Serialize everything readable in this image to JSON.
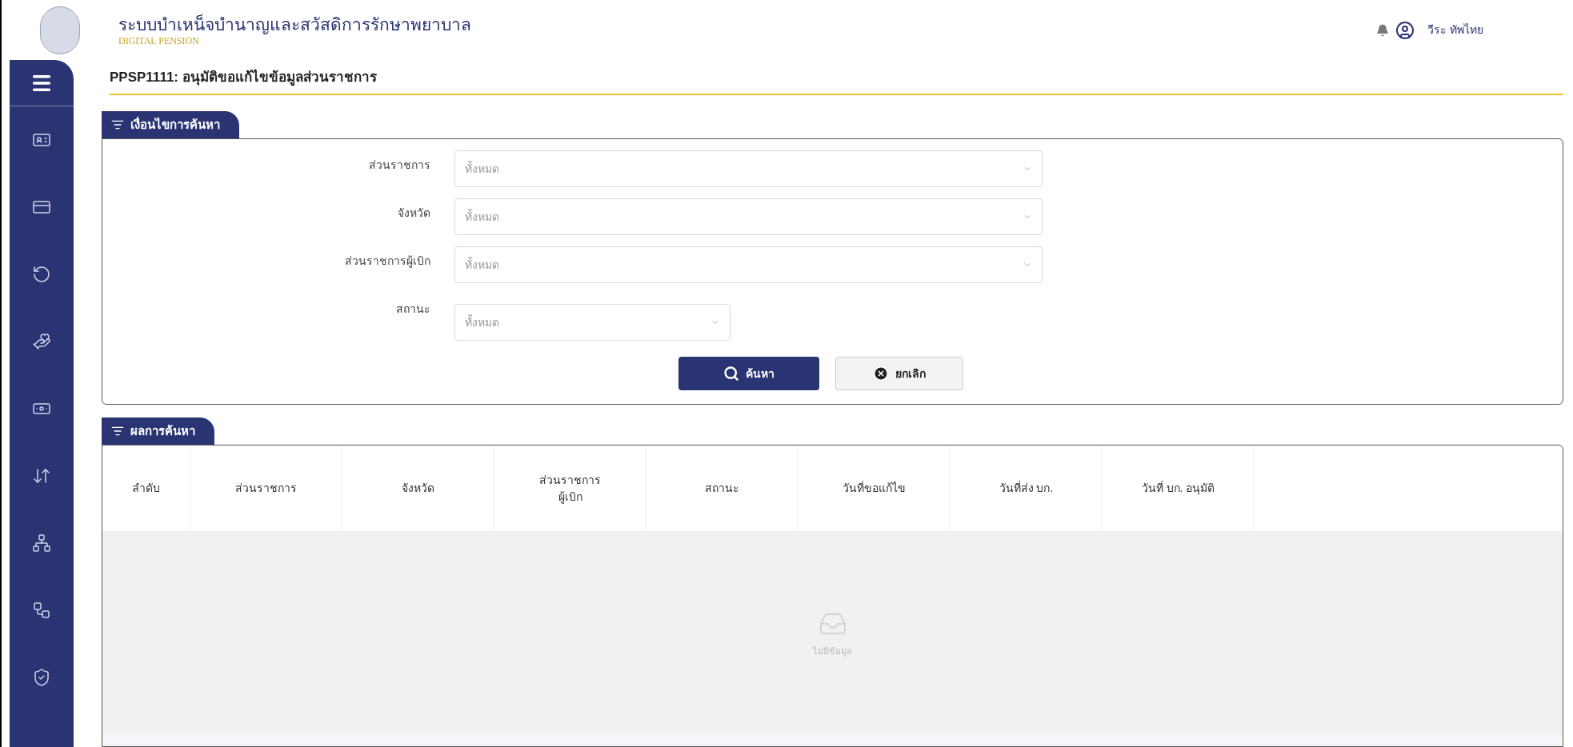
{
  "header": {
    "title": "ระบบบำเหน็จบำนาญและสวัสดิการรักษาพยาบาล",
    "subtitle": "DIGITAL PENSION",
    "user": "วีระ ทัพไทย"
  },
  "page_title": "PPSP1111: อนุมัติขอแก้ไขข้อมูลส่วนราชการ",
  "filter": {
    "title": "เงื่อนไขการค้นหา",
    "fields": [
      {
        "label": "ส่วนราชการ",
        "placeholder": "ทั้งหมด",
        "wide": true
      },
      {
        "label": "จังหวัด",
        "placeholder": "ทั้งหมด",
        "wide": true
      },
      {
        "label": "ส่วนราชการผู้เบิก",
        "placeholder": "ทั้งหมด",
        "wide": true
      },
      {
        "label": "สถานะ",
        "placeholder": "ทั้งหมด",
        "wide": false
      }
    ],
    "buttons": [
      {
        "kind": "primary",
        "label": "ค้นหา"
      },
      {
        "kind": "cancel",
        "label": "ยกเลิก"
      }
    ]
  },
  "results": {
    "title": "ผลการค้นหา",
    "columns": [
      {
        "lines": [
          "ลำดับ"
        ]
      },
      {
        "lines": [
          "ส่วนราชการ"
        ]
      },
      {
        "lines": [
          "จังหวัด"
        ]
      },
      {
        "lines": [
          "ส่วนราชการ",
          "ผู้เบิก"
        ]
      },
      {
        "lines": [
          "สถานะ"
        ]
      },
      {
        "lines": [
          "วันที่ขอแก้ไข"
        ]
      },
      {
        "lines": [
          "วันที่ส่ง บก."
        ]
      },
      {
        "lines": [
          "วันที่ บก. อนุมัติ"
        ]
      }
    ],
    "empty_text": "ไม่มีข้อมูล"
  }
}
